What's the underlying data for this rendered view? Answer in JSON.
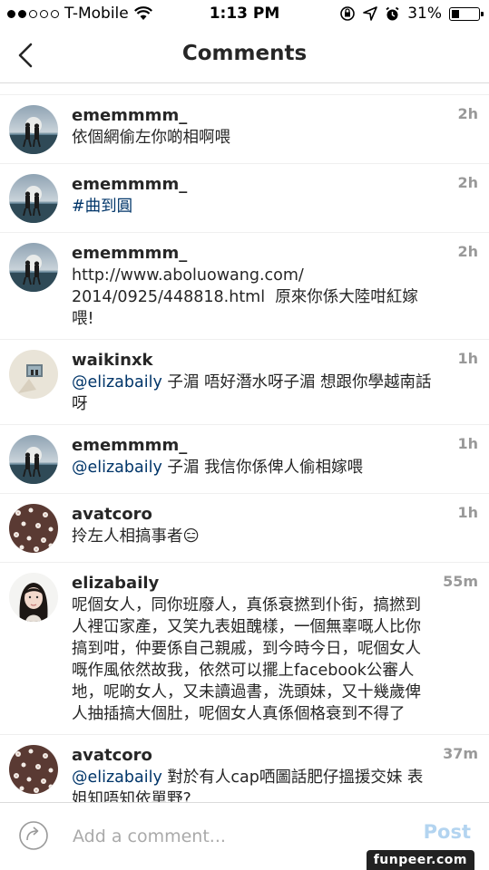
{
  "status_bar": {
    "carrier": "T-Mobile",
    "time": "1:13 PM",
    "battery": "31%",
    "battery_level": 0.31,
    "signal_bars_filled": 2,
    "signal_bars_total": 5
  },
  "nav": {
    "title": "Comments",
    "back_icon": "chevron-left-icon"
  },
  "comments": [
    {
      "username": "ememmmm_",
      "time": "2h",
      "parts": [
        {
          "t": "依個網偷左你啲相啊喂",
          "kind": "text"
        }
      ],
      "avatar": "beach"
    },
    {
      "username": "ememmmm_",
      "time": "2h",
      "parts": [
        {
          "t": "#曲到圓",
          "kind": "hashtag"
        }
      ],
      "avatar": "beach"
    },
    {
      "username": "ememmmm_",
      "time": "2h",
      "parts": [
        {
          "t": "http://www.aboluowang.com/\n2014/0925/448818.html  原來你係大陸咁紅嫁喂!",
          "kind": "text"
        }
      ],
      "avatar": "beach"
    },
    {
      "username": "waikinxk",
      "time": "1h",
      "parts": [
        {
          "t": "@elizabaily",
          "kind": "mention"
        },
        {
          "t": " 子湄 唔好潛水呀子湄 想跟你學越南話呀",
          "kind": "text"
        }
      ],
      "avatar": "photo"
    },
    {
      "username": "ememmmm_",
      "time": "1h",
      "parts": [
        {
          "t": "@elizabaily",
          "kind": "mention"
        },
        {
          "t": " 子湄 我信你係俾人偷相嫁喂",
          "kind": "text"
        }
      ],
      "avatar": "beach"
    },
    {
      "username": "avatcoro",
      "time": "1h",
      "parts": [
        {
          "t": "拎左人相搞事者😑",
          "kind": "text"
        }
      ],
      "avatar": "floral"
    },
    {
      "username": "elizabaily",
      "time": "55m",
      "parts": [
        {
          "t": "呢個女人，同你班廢人，真係衰撚到仆街，搞撚到人裡冚家產，又笑九表姐醜樣，一個無辜嘅人比你搞到咁，仲要係自己親戚，到今時今日，呢個女人嘅作風依然故我，依然可以擺上facebook公審人地，呢啲女人，又未讀過書，洗頭妹，又十幾歲俾人抽插搞大個肚，呢個女人真係個格衰到不得了",
          "kind": "text"
        }
      ],
      "avatar": "girl"
    },
    {
      "username": "avatcoro",
      "time": "37m",
      "parts": [
        {
          "t": "@elizabaily",
          "kind": "mention"
        },
        {
          "t": " 對於有人cap哂圖話肥仔搵援交妹 表姐知唔知依單野?",
          "kind": "text"
        }
      ],
      "avatar": "floral"
    }
  ],
  "input_bar": {
    "placeholder": "Add a comment...",
    "post_label": "Post",
    "reply_icon": "reply-arrow-icon"
  },
  "watermark": "funpeer.com"
}
